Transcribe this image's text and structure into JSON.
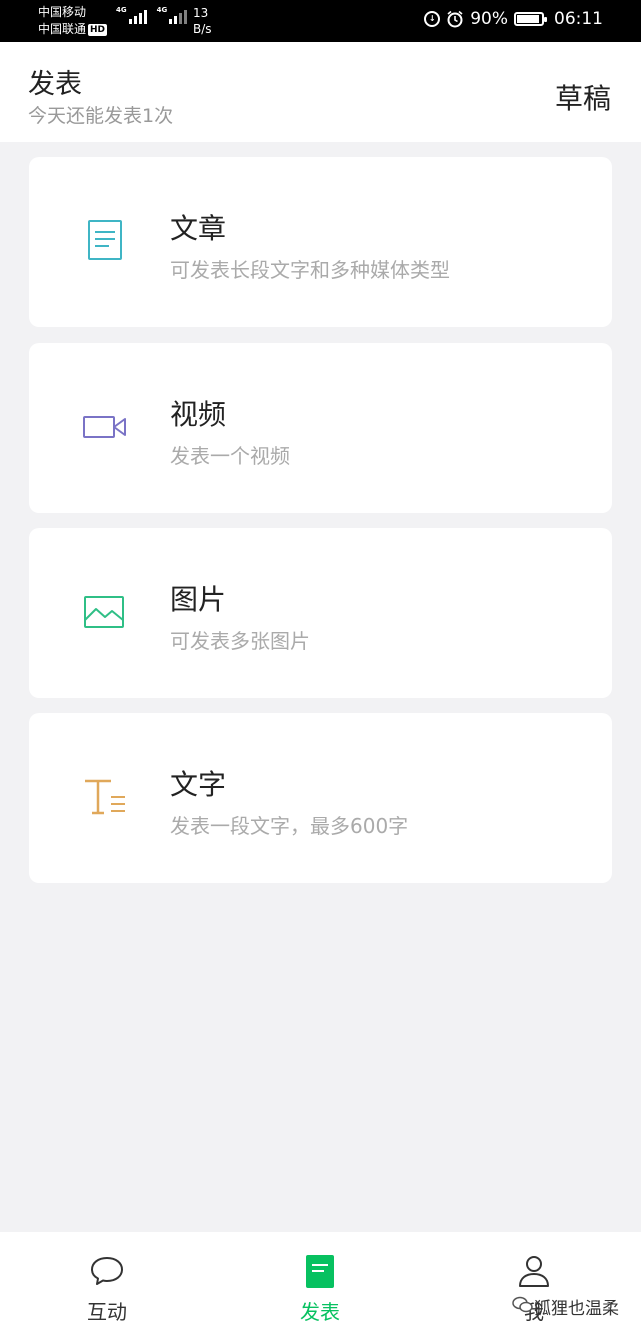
{
  "status_bar": {
    "carrier1": "中国移动",
    "carrier2": "中国联通",
    "hd_badge": "HD",
    "network1": "4G",
    "network2": "4G",
    "speed_value": "13",
    "speed_unit": "B/s",
    "battery_percent": "90%",
    "battery_level": 0.9,
    "time": "06:11"
  },
  "header": {
    "title": "发表",
    "subtitle": "今天还能发表1次",
    "drafts_label": "草稿"
  },
  "options": [
    {
      "icon": "article-icon",
      "title": "文章",
      "description": "可发表长段文字和多种媒体类型",
      "color": "#3fb5c5"
    },
    {
      "icon": "video-icon",
      "title": "视频",
      "description": "发表一个视频",
      "color": "#7a73c6"
    },
    {
      "icon": "image-icon",
      "title": "图片",
      "description": "可发表多张图片",
      "color": "#2fbf86"
    },
    {
      "icon": "text-icon",
      "title": "文字",
      "description": "发表一段文字，最多600字",
      "color": "#e0a85a"
    }
  ],
  "tab_bar": {
    "tabs": [
      {
        "label": "互动",
        "icon": "chat-bubble-icon",
        "active": false
      },
      {
        "label": "发表",
        "icon": "publish-document-icon",
        "active": true
      },
      {
        "label": "我",
        "icon": "person-icon",
        "active": false
      }
    ],
    "active_color": "#07c160"
  },
  "watermark": "狐狸也温柔"
}
